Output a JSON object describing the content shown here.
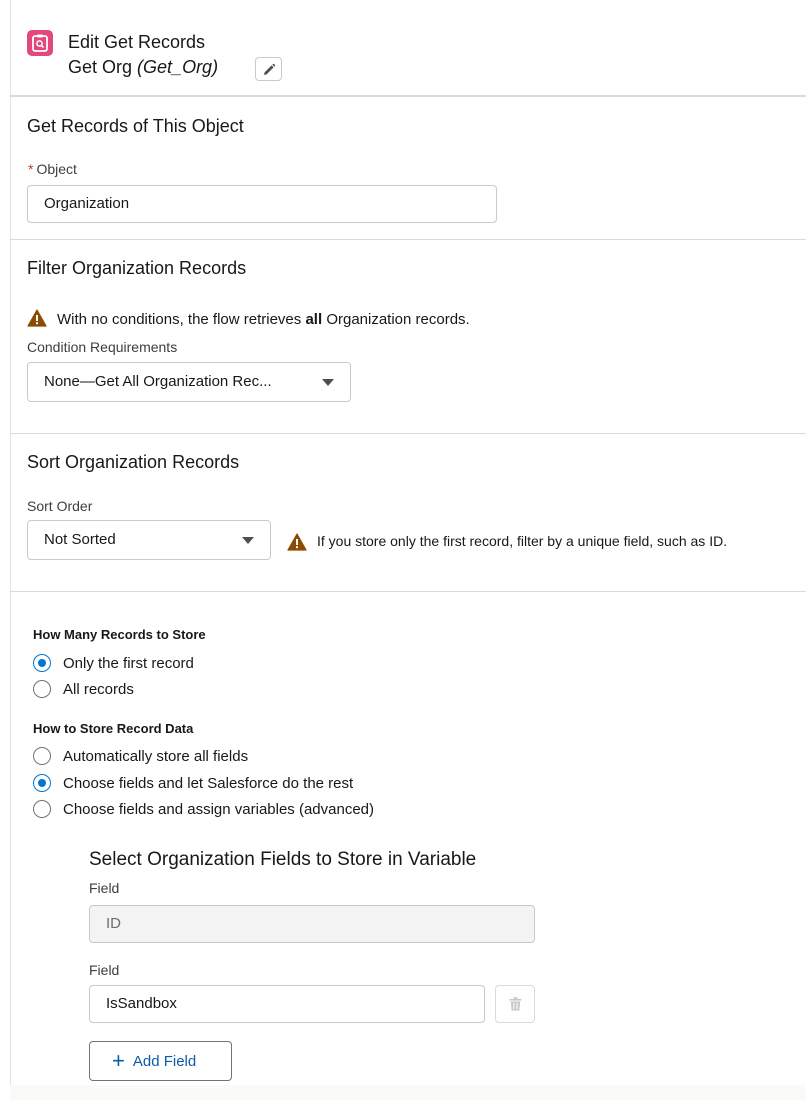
{
  "header": {
    "title": "Edit Get Records",
    "element_label": "Get Org",
    "element_api": "(Get_Org)",
    "icon": "get-records-icon",
    "icon_color": "#e3477b"
  },
  "object_section": {
    "title": "Get Records of This Object",
    "required_mark": "*",
    "object_label": "Object",
    "object_value": "Organization"
  },
  "filter_section": {
    "title": "Filter Organization Records",
    "warning_prefix": "With no conditions, the flow retrieves",
    "warning_bold": "all",
    "warning_suffix": "Organization records.",
    "condition_label": "Condition Requirements",
    "condition_value": "None—Get All Organization Rec..."
  },
  "sort_section": {
    "title": "Sort Organization Records",
    "sort_label": "Sort Order",
    "sort_value": "Not Sorted",
    "sort_warning": "If you store only the first record, filter by a unique field, such as ID."
  },
  "store_section": {
    "how_many_label": "How Many Records to Store",
    "how_many_options": [
      {
        "label": "Only the first record",
        "selected": true
      },
      {
        "label": "All records",
        "selected": false
      }
    ],
    "how_to_store_label": "How to Store Record Data",
    "how_to_store_options": [
      {
        "label": "Automatically store all fields",
        "selected": false
      },
      {
        "label": "Choose fields and let Salesforce do the rest",
        "selected": true
      },
      {
        "label": "Choose fields and assign variables (advanced)",
        "selected": false
      }
    ]
  },
  "fields_section": {
    "title": "Select Organization Fields to Store in Variable",
    "fields": [
      {
        "label": "Field",
        "value": "ID",
        "disabled": true
      },
      {
        "label": "Field",
        "value": "IsSandbox",
        "disabled": false
      }
    ],
    "add_field_label": "Add Field"
  },
  "colors": {
    "accent": "#0176d3",
    "warning": "#8c4b02",
    "link": "#0b5cab"
  }
}
